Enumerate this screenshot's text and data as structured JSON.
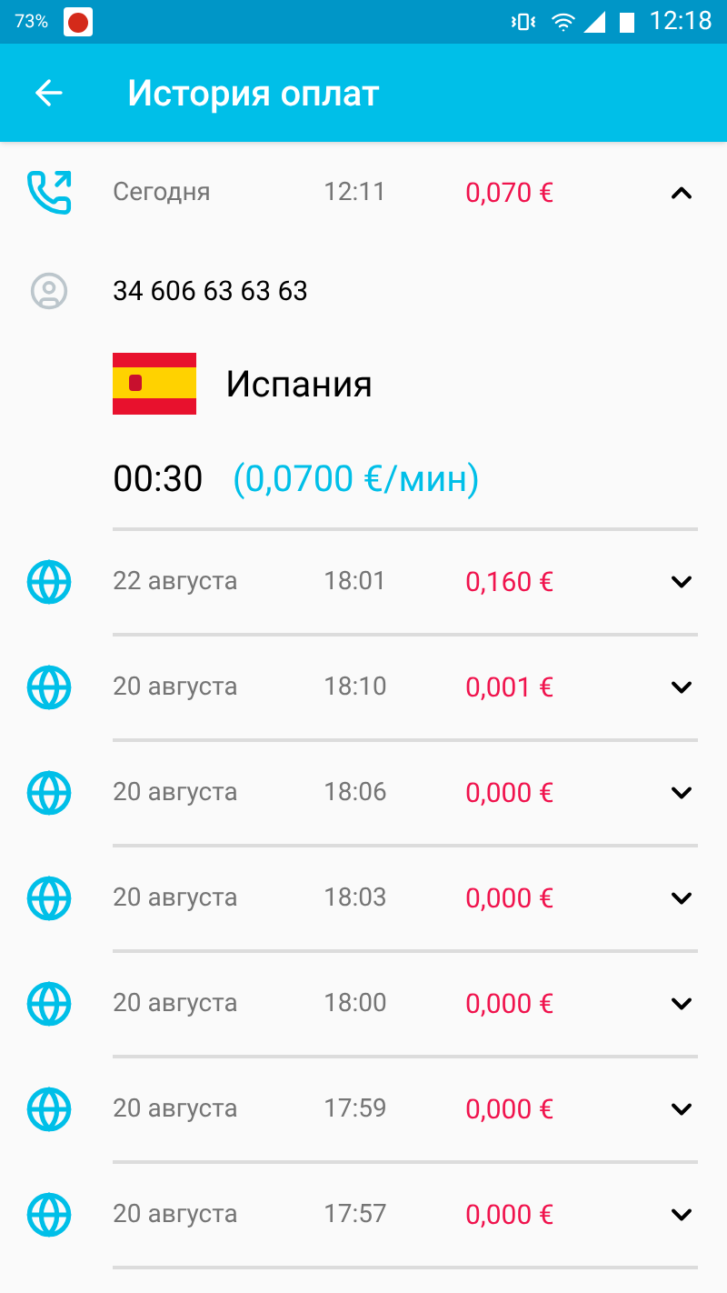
{
  "status_bar": {
    "battery_percent": "73%",
    "time": "12:18"
  },
  "app_bar": {
    "title": "История оплат"
  },
  "payments": [
    {
      "kind": "call",
      "date": "Сегодня",
      "time": "12:11",
      "amount": "0,070 €",
      "expanded": true,
      "details": {
        "number": "34 606 63 63 63",
        "country": "Испания",
        "duration": "00:30",
        "rate": "(0,0700 €/мин)"
      }
    },
    {
      "kind": "web",
      "date": "22 августа",
      "time": "18:01",
      "amount": "0,160 €",
      "expanded": false
    },
    {
      "kind": "web",
      "date": "20 августа",
      "time": "18:10",
      "amount": "0,001 €",
      "expanded": false
    },
    {
      "kind": "web",
      "date": "20 августа",
      "time": "18:06",
      "amount": "0,000 €",
      "expanded": false
    },
    {
      "kind": "web",
      "date": "20 августа",
      "time": "18:03",
      "amount": "0,000 €",
      "expanded": false
    },
    {
      "kind": "web",
      "date": "20 августа",
      "time": "18:00",
      "amount": "0,000 €",
      "expanded": false
    },
    {
      "kind": "web",
      "date": "20 августа",
      "time": "17:59",
      "amount": "0,000 €",
      "expanded": false
    },
    {
      "kind": "web",
      "date": "20 августа",
      "time": "17:57",
      "amount": "0,000 €",
      "expanded": false
    }
  ]
}
